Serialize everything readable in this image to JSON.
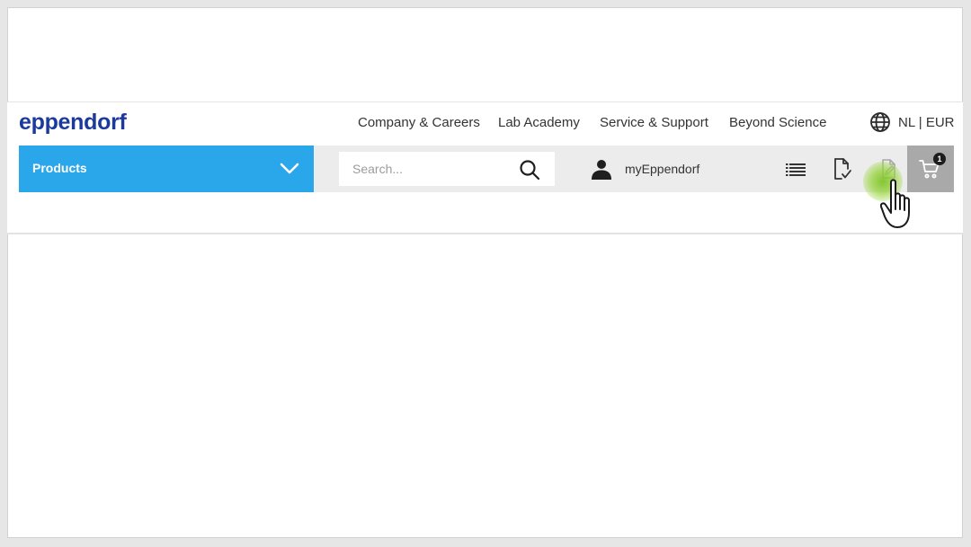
{
  "logo": {
    "text": "eppendorf"
  },
  "top_nav": {
    "items": [
      {
        "label": "Company & Careers"
      },
      {
        "label": "Lab Academy"
      },
      {
        "label": "Service & Support"
      },
      {
        "label": "Beyond Science"
      }
    ],
    "language": {
      "icon": "globe-icon",
      "label": "NL | EUR"
    }
  },
  "main_nav": {
    "products": {
      "label": "Products",
      "icon": "chevron-down-icon"
    },
    "search": {
      "placeholder": "Search...",
      "icon": "search-icon"
    },
    "account": {
      "label": "myEppendorf",
      "icon": "user-icon"
    },
    "tools": [
      {
        "icon": "list-icon"
      },
      {
        "icon": "document-check-icon"
      },
      {
        "icon": "document-edit-icon"
      }
    ],
    "cart": {
      "icon": "cart-icon",
      "count": "1"
    }
  },
  "colors": {
    "brand": "#1a3a9e",
    "products_bar": "#2aa6ea",
    "nav_background": "#ececec",
    "cart_background": "#a9a9a9",
    "click_highlight": "#7ec428"
  }
}
